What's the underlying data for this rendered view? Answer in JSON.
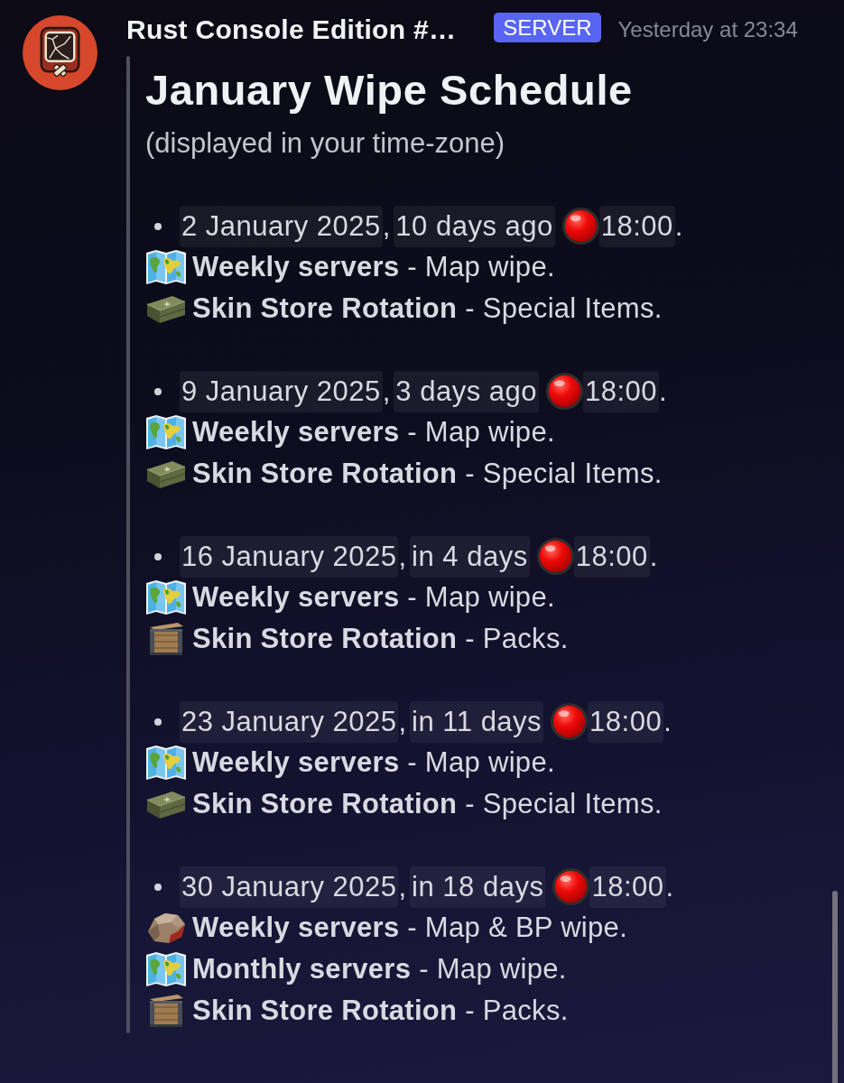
{
  "message": {
    "author": "Rust Console Edition #…",
    "badge": "SERVER",
    "timestamp": "Yesterday at 23:34"
  },
  "embed": {
    "title": "January Wipe Schedule",
    "subtitle": "(displayed in your time-zone)",
    "entries": [
      {
        "date": "2 January 2025",
        "after_date": ",",
        "relative": "10 days ago",
        "time": "18:00",
        "after_time": ".",
        "lines": [
          {
            "kind": "map",
            "text": "**Weekly servers** - Map wipe."
          },
          {
            "kind": "items",
            "text": "**Skin Store Rotation** - Special Items."
          }
        ]
      },
      {
        "date": "9 January 2025",
        "after_date": ",",
        "relative": "3 days ago",
        "time": "18:00",
        "after_time": ".",
        "lines": [
          {
            "kind": "map",
            "text": "**Weekly servers** - Map wipe."
          },
          {
            "kind": "items",
            "text": "**Skin Store Rotation** - Special Items."
          }
        ]
      },
      {
        "date": "16 January 2025",
        "after_date": ",",
        "relative": "in 4 days",
        "time": "18:00",
        "after_time": ".",
        "lines": [
          {
            "kind": "map",
            "text": "**Weekly servers** - Map wipe."
          },
          {
            "kind": "packs",
            "text": "**Skin Store Rotation** - Packs."
          }
        ]
      },
      {
        "date": "23 January 2025",
        "after_date": ",",
        "relative": "in 11 days",
        "time": "18:00",
        "after_time": ".",
        "lines": [
          {
            "kind": "map",
            "text": "**Weekly servers** - Map wipe."
          },
          {
            "kind": "items",
            "text": "**Skin Store Rotation** - Special Items."
          }
        ]
      },
      {
        "date": "30 January 2025",
        "after_date": ",",
        "relative": "in 18 days",
        "time": "18:00",
        "after_time": ".",
        "lines": [
          {
            "kind": "bp",
            "text": "**Weekly servers** - Map & BP wipe."
          },
          {
            "kind": "map",
            "text": "**Monthly servers** - Map wipe."
          },
          {
            "kind": "packs",
            "text": "**Skin Store Rotation** - Packs."
          }
        ]
      }
    ]
  }
}
